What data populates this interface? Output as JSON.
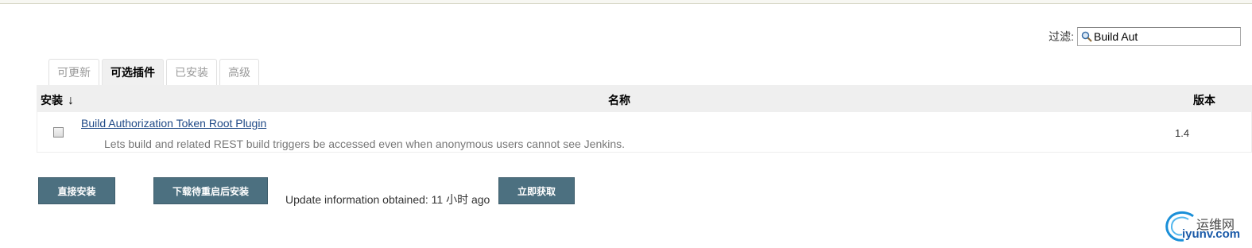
{
  "filter": {
    "label": "过滤:",
    "value": "Build Aut"
  },
  "tabs": [
    {
      "label": "可更新",
      "active": false
    },
    {
      "label": "可选插件",
      "active": true
    },
    {
      "label": "已安装",
      "active": false
    },
    {
      "label": "高级",
      "active": false
    }
  ],
  "table": {
    "headers": {
      "install": "安装",
      "sort_arrow": "↓",
      "name": "名称",
      "version": "版本"
    },
    "rows": [
      {
        "checked": false,
        "name": "Build Authorization Token Root Plugin",
        "description": "Lets build and related REST build triggers be accessed even when anonymous users cannot see Jenkins.",
        "version": "1.4"
      }
    ]
  },
  "actions": {
    "install_now": "直接安装",
    "download_restart": "下载待重启后安装",
    "update_info": "Update information obtained: 11 小时 ago",
    "fetch_now": "立即获取"
  },
  "watermark": {
    "cn": "运维网",
    "en": "iyunv.com"
  },
  "colors": {
    "button_bg": "#4c7080",
    "link": "#204a87",
    "header_bg": "#efefef"
  }
}
